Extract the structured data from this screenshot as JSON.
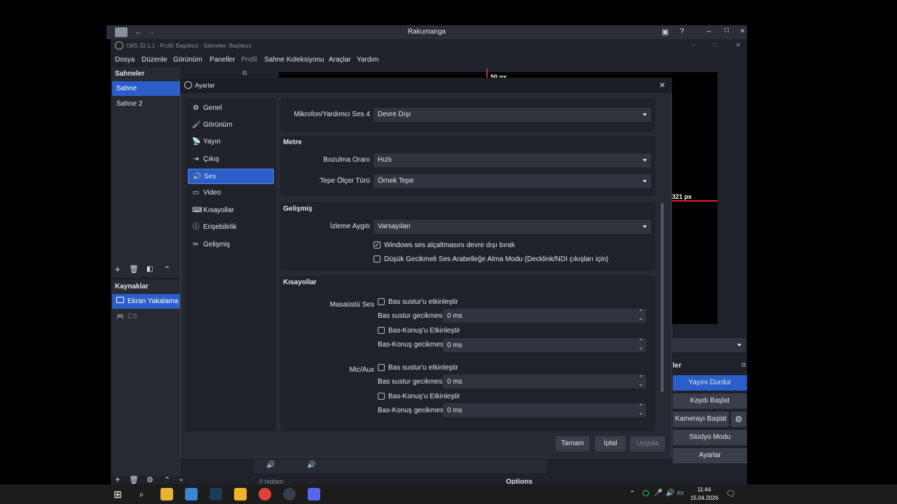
{
  "outer": {
    "title": "Rakumanga"
  },
  "obs": {
    "title": "OBS 32.1.1 - Profil: Başlıksız - Sahneler: Başlıksız",
    "menu": [
      "Dosya",
      "Düzenle",
      "Görünüm",
      "Paneller",
      "Profil",
      "Sahne Koleksiyonu",
      "Araçlar",
      "Yardım"
    ],
    "scenes_header": "Sahneler",
    "scenes": [
      "Sahne",
      "Sahne 2"
    ],
    "sources_header": "Kaynaklar",
    "sources": [
      "Ekran Yakalama",
      "CS"
    ],
    "preview_label_top": "50 px",
    "preview_label_right": "321 px",
    "controls_header": "ler",
    "controls": [
      "Yayını Durdur",
      "Kaydı Başlat",
      "Kamerayı Başlat",
      "Stüdyo Modu",
      "Ayarlar"
    ],
    "mixer_hidden": "0 hidden",
    "options_label": "Options"
  },
  "settings": {
    "title": "Ayarlar",
    "nav": [
      {
        "label": "Genel",
        "icon": "⚙"
      },
      {
        "label": "Görünüm",
        "icon": "🖌"
      },
      {
        "label": "Yayın",
        "icon": "📡"
      },
      {
        "label": "Çıkış",
        "icon": "⇥"
      },
      {
        "label": "Ses",
        "icon": "🔊"
      },
      {
        "label": "Video",
        "icon": "▭"
      },
      {
        "label": "Kısayollar",
        "icon": "⌨"
      },
      {
        "label": "Erişebilirlik",
        "icon": "ⓘ"
      },
      {
        "label": "Gelişmiş",
        "icon": "✂"
      }
    ],
    "mic4_label": "Mikrofon/Yardımcı Ses 4",
    "mic4_value": "Devre Dışı",
    "metre": {
      "header": "Metre",
      "decay_label": "Bozulma Oranı",
      "decay_value": "Hızlı",
      "peak_label": "Tepe Ölçer Türü",
      "peak_value": "Örnek Tepe"
    },
    "advanced": {
      "header": "Gelişmiş",
      "monitor_label": "İzleme Aygıtı",
      "monitor_value": "Varsayılan",
      "ducking_label": "Windows ses alçaltmasını devre dışı bırak",
      "ducking_checked": true,
      "lowlatency_label": "Düşük Gecikmeli Ses Arabelleğe Alma Modu (Decklink/NDI çıkışları için)",
      "lowlatency_checked": false
    },
    "hotkeys": {
      "header": "Kısayollar",
      "desktop_label": "Masaüstü Ses",
      "mic_label": "Mic/Aux",
      "ptm_enable": "Bas sustur'u etkinleştir",
      "ptm_delay": "Bas sustur gecikmesi",
      "ptt_enable": "Bas-Konuş'u Etkinleştir",
      "ptt_delay": "Bas-Konuş gecikmesi",
      "delay_value": "0 ms"
    },
    "buttons": {
      "ok": "Tamam",
      "cancel": "İptal",
      "apply": "Uygula"
    }
  },
  "taskbar": {
    "time": "11:44",
    "date": "15.04.2026"
  }
}
